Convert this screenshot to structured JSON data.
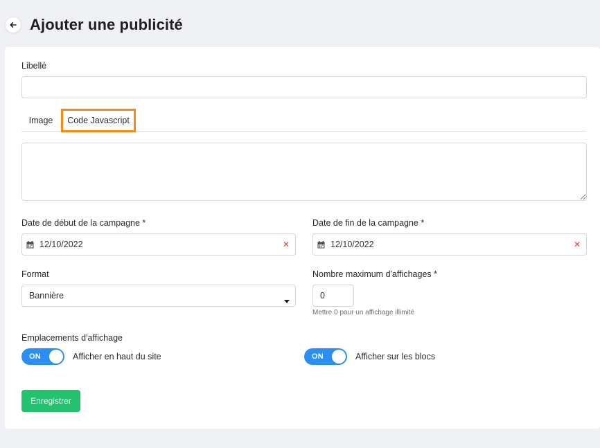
{
  "header": {
    "title": "Ajouter une publicité",
    "back_icon": "arrow-left-icon"
  },
  "form": {
    "libelle": {
      "label": "Libellé",
      "value": "",
      "placeholder": ""
    },
    "tabs": [
      {
        "label": "Image",
        "active": false
      },
      {
        "label": "Code Javascript",
        "active": true,
        "highlight_color": "#f78c14"
      }
    ],
    "code": {
      "value": ""
    },
    "start_date": {
      "label": "Date de début de la campagne *",
      "value": "12/10/2022",
      "icon": "calendar-icon",
      "clear_icon": "clear-x-icon"
    },
    "end_date": {
      "label": "Date de fin de la campagne *",
      "value": "12/10/2022",
      "icon": "calendar-icon",
      "clear_icon": "clear-x-icon"
    },
    "format": {
      "label": "Format",
      "value": "Bannière",
      "icon": "caret-down-icon"
    },
    "max_views": {
      "label": "Nombre maximum d'affichages *",
      "value": "0",
      "hint": "Mettre 0 pour un affichage illimité"
    },
    "placements": {
      "label": "Emplacements d'affichage",
      "items": [
        {
          "toggle_text": "ON",
          "label": "Afficher en haut du site",
          "on": true
        },
        {
          "toggle_text": "ON",
          "label": "Afficher sur les blocs",
          "on": true
        }
      ]
    },
    "submit_label": "Enregistrer"
  },
  "colors": {
    "accent_blue": "#2b8ff1",
    "success_green": "#22c26f",
    "clear_red": "#e3423f",
    "highlight_orange": "#f78c14"
  }
}
